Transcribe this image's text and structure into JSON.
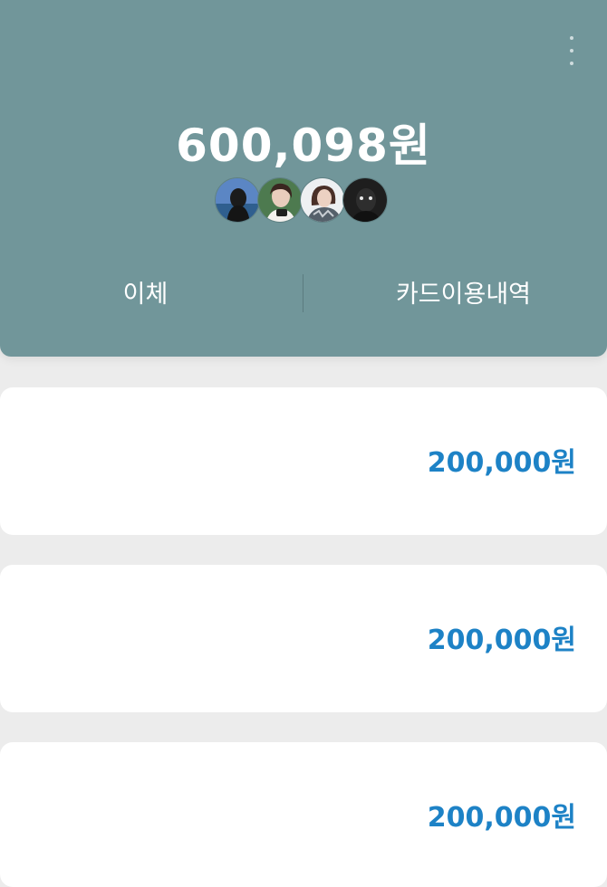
{
  "header": {
    "balance": "600,098원",
    "members": [
      {
        "name": "member-1",
        "colors": [
          "#3d78c0",
          "#1a1a1a"
        ]
      },
      {
        "name": "member-2",
        "colors": [
          "#3c8a5a",
          "#e8cfc2"
        ]
      },
      {
        "name": "member-3",
        "colors": [
          "#eef0f2",
          "#4a3a33"
        ]
      },
      {
        "name": "member-4",
        "colors": [
          "#2b2b2b",
          "#0d0d0d"
        ]
      }
    ]
  },
  "actions": {
    "transfer_label": "이체",
    "card_history_label": "카드이용내역"
  },
  "accounts": [
    {
      "amount": "200,000원"
    },
    {
      "amount": "200,000원"
    },
    {
      "amount": "200,000원"
    }
  ],
  "colors": {
    "header_bg": "#71969a",
    "amount_text": "#1d82c6",
    "page_bg": "#ececec"
  }
}
